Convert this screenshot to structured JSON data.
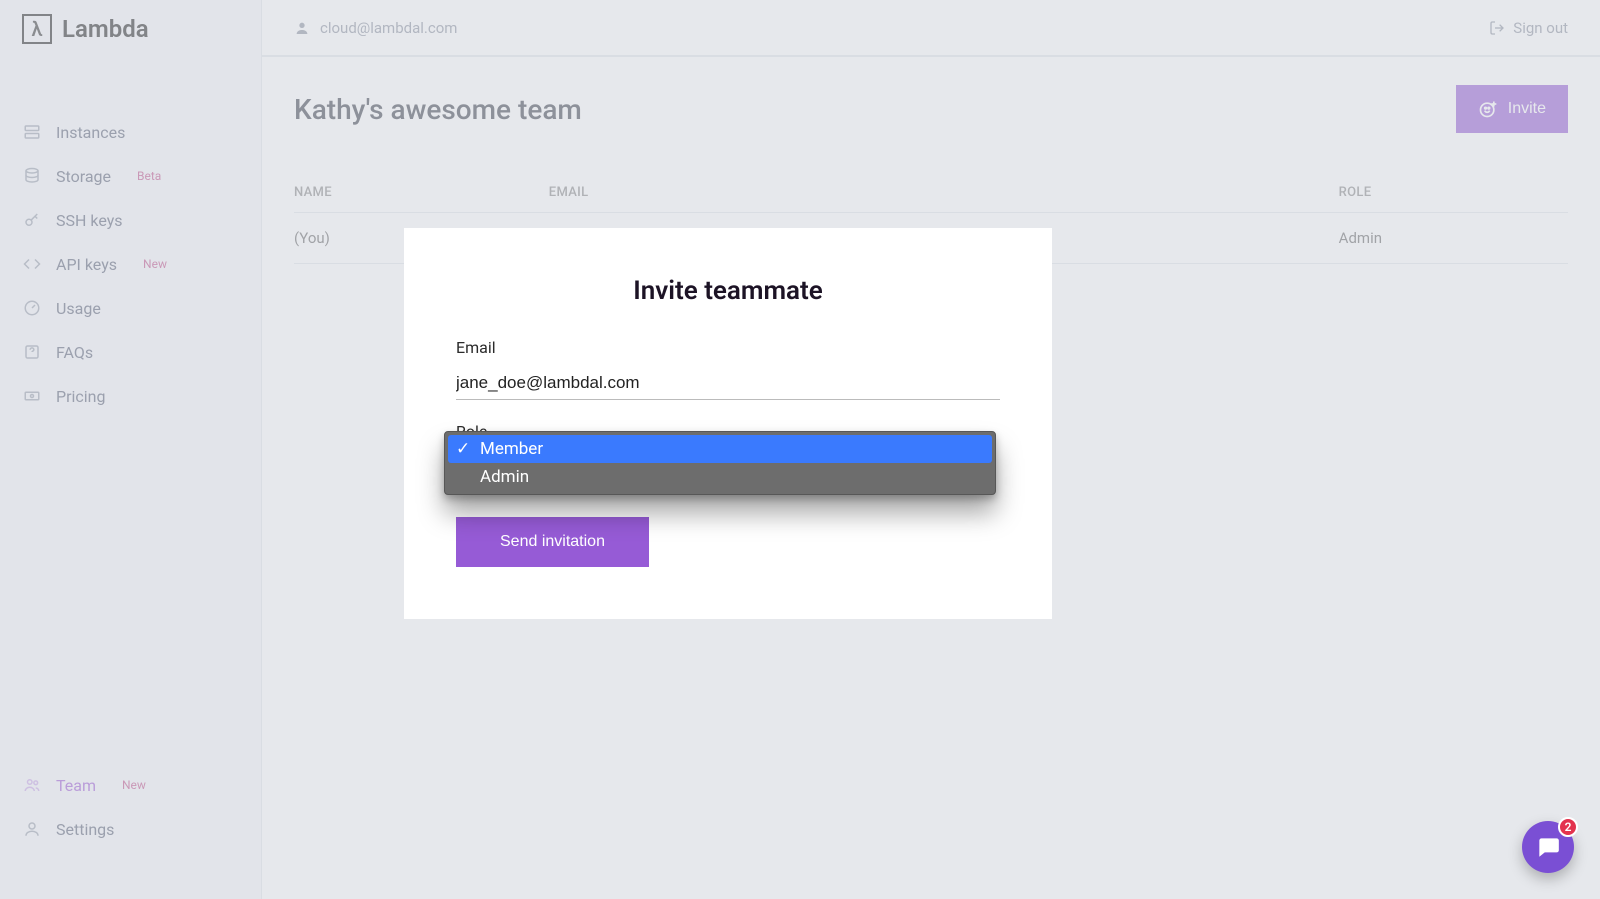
{
  "brand": {
    "name": "Lambda"
  },
  "header": {
    "user_email": "cloud@lambdal.com",
    "signout": "Sign out"
  },
  "sidebar": {
    "items": [
      {
        "label": "Instances",
        "badge": ""
      },
      {
        "label": "Storage",
        "badge": "Beta"
      },
      {
        "label": "SSH keys",
        "badge": ""
      },
      {
        "label": "API keys",
        "badge": "New"
      },
      {
        "label": "Usage",
        "badge": ""
      },
      {
        "label": "FAQs",
        "badge": ""
      },
      {
        "label": "Pricing",
        "badge": ""
      }
    ],
    "bottom": [
      {
        "label": "Team",
        "badge": "New"
      },
      {
        "label": "Settings",
        "badge": ""
      }
    ]
  },
  "page": {
    "title": "Kathy's awesome team",
    "invite_label": "Invite",
    "table": {
      "headers": {
        "name": "NAME",
        "email": "EMAIL",
        "role": "ROLE"
      },
      "rows": [
        {
          "name": "(You)",
          "email": "",
          "role": "Admin"
        }
      ]
    }
  },
  "modal": {
    "title": "Invite teammate",
    "email_label": "Email",
    "email_value": "jane_doe@lambdal.com",
    "role_label": "Role",
    "options": [
      {
        "label": "Member",
        "selected": true
      },
      {
        "label": "Admin",
        "selected": false
      }
    ],
    "send_label": "Send invitation"
  },
  "chat": {
    "count": "2"
  }
}
